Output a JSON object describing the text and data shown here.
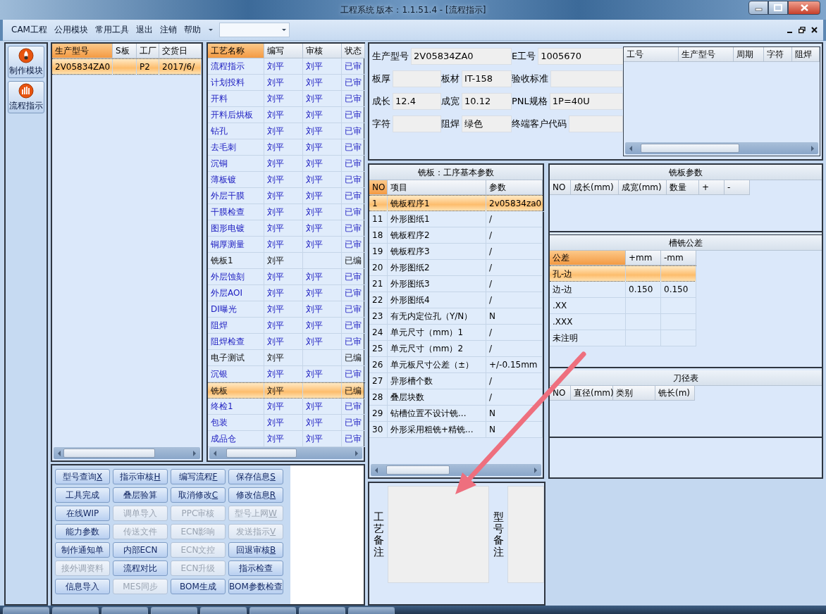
{
  "window": {
    "title": "工程系统   版本：1.1.51.4 - [流程指示]"
  },
  "menu": {
    "items": [
      "CAM工程",
      "公用模块",
      "常用工具",
      "退出",
      "注销",
      "帮助"
    ]
  },
  "navigation": [
    {
      "label": "制作模块"
    },
    {
      "label": "流程指示"
    }
  ],
  "products": {
    "columns": [
      "生产型号",
      "S板",
      "工厂",
      "交货日"
    ],
    "rows": [
      {
        "model": "2V05834ZA0",
        "factory": "P2",
        "delivery_date": "2017/6/",
        "selected": true
      }
    ]
  },
  "processes": {
    "columns": [
      "工艺名称",
      "编写",
      "审核",
      "状态"
    ],
    "rows": [
      {
        "name": "流程指示",
        "writer": "刘平",
        "reviewer": "刘平",
        "status": "已审",
        "reviewed": true,
        "selected": false
      },
      {
        "name": "计划投料",
        "writer": "刘平",
        "reviewer": "刘平",
        "status": "已审",
        "reviewed": true,
        "selected": false
      },
      {
        "name": "开料",
        "writer": "刘平",
        "reviewer": "刘平",
        "status": "已审",
        "reviewed": true,
        "selected": false
      },
      {
        "name": "开料后烘板",
        "writer": "刘平",
        "reviewer": "刘平",
        "status": "已审",
        "reviewed": true,
        "selected": false
      },
      {
        "name": "钻孔",
        "writer": "刘平",
        "reviewer": "刘平",
        "status": "已审",
        "reviewed": true,
        "selected": false
      },
      {
        "name": "去毛刺",
        "writer": "刘平",
        "reviewer": "刘平",
        "status": "已审",
        "reviewed": true,
        "selected": false
      },
      {
        "name": "沉铜",
        "writer": "刘平",
        "reviewer": "刘平",
        "status": "已审",
        "reviewed": true,
        "selected": false
      },
      {
        "name": "薄板镀",
        "writer": "刘平",
        "reviewer": "刘平",
        "status": "已审",
        "reviewed": true,
        "selected": false
      },
      {
        "name": "外层干膜",
        "writer": "刘平",
        "reviewer": "刘平",
        "status": "已审",
        "reviewed": true,
        "selected": false
      },
      {
        "name": "干膜检查",
        "writer": "刘平",
        "reviewer": "刘平",
        "status": "已审",
        "reviewed": true,
        "selected": false
      },
      {
        "name": "图形电镀",
        "writer": "刘平",
        "reviewer": "刘平",
        "status": "已审",
        "reviewed": true,
        "selected": false
      },
      {
        "name": "铜厚测量",
        "writer": "刘平",
        "reviewer": "刘平",
        "status": "已审",
        "reviewed": true,
        "selected": false
      },
      {
        "name": "铣板1",
        "writer": "刘平",
        "status": "已编",
        "reviewed": false,
        "selected": false
      },
      {
        "name": "外层蚀刻",
        "writer": "刘平",
        "reviewer": "刘平",
        "status": "已审",
        "reviewed": true,
        "selected": false
      },
      {
        "name": "外层AOI",
        "writer": "刘平",
        "reviewer": "刘平",
        "status": "已审",
        "reviewed": true,
        "selected": false
      },
      {
        "name": "DI曝光",
        "writer": "刘平",
        "reviewer": "刘平",
        "status": "已审",
        "reviewed": true,
        "selected": false
      },
      {
        "name": "阻焊",
        "writer": "刘平",
        "reviewer": "刘平",
        "status": "已审",
        "reviewed": true,
        "selected": false
      },
      {
        "name": "阻焊检查",
        "writer": "刘平",
        "reviewer": "刘平",
        "status": "已审",
        "reviewed": true,
        "selected": false
      },
      {
        "name": "电子测试",
        "writer": "刘平",
        "status": "已编",
        "reviewed": false,
        "selected": false
      },
      {
        "name": "沉银",
        "writer": "刘平",
        "reviewer": "刘平",
        "status": "已审",
        "reviewed": true,
        "selected": false
      },
      {
        "name": "铣板",
        "writer": "刘平",
        "status": "已编",
        "reviewed": false,
        "selected": true
      },
      {
        "name": "终检1",
        "writer": "刘平",
        "reviewer": "刘平",
        "status": "已审",
        "reviewed": true,
        "selected": false
      },
      {
        "name": "包装",
        "writer": "刘平",
        "reviewer": "刘平",
        "status": "已审",
        "reviewed": true,
        "selected": false
      },
      {
        "name": "成品仓",
        "writer": "刘平",
        "reviewer": "刘平",
        "status": "已审",
        "reviewed": true,
        "selected": false
      }
    ]
  },
  "job_info": {
    "fields": [
      {
        "label": "生产型号",
        "value": "2V05834ZA0"
      },
      {
        "label": "E工号",
        "value": "1005670"
      },
      {
        "label": "板厚"
      },
      {
        "label": "板材",
        "value": "IT-158"
      },
      {
        "label": "验收标准"
      },
      {
        "label": "成长",
        "value": "12.4"
      },
      {
        "label": "成宽",
        "value": "10.12"
      },
      {
        "label": "PNL规格",
        "value": "1P=40U"
      },
      {
        "label": "字符"
      },
      {
        "label": "阻焊",
        "value": "绿色"
      },
      {
        "label": "终端客户代码"
      }
    ]
  },
  "job_list": {
    "columns": [
      "工号",
      "生产型号",
      "周期",
      "字符",
      "阻焊"
    ]
  },
  "basic_params": {
    "title": "铣板：工序基本参数",
    "columns": [
      "NO",
      "项目",
      "参数"
    ],
    "rows": [
      {
        "no": "1",
        "item": "铣板程序1",
        "value": "2v05834za0",
        "selected": true
      },
      {
        "no": "11",
        "item": "外形图纸1",
        "value": "/",
        "selected": false
      },
      {
        "no": "18",
        "item": "铣板程序2",
        "value": "/",
        "selected": false
      },
      {
        "no": "19",
        "item": "铣板程序3",
        "value": "/",
        "selected": false
      },
      {
        "no": "20",
        "item": "外形图纸2",
        "value": "/",
        "selected": false
      },
      {
        "no": "21",
        "item": "外形图纸3",
        "value": "/",
        "selected": false
      },
      {
        "no": "22",
        "item": "外形图纸4",
        "value": "/",
        "selected": false
      },
      {
        "no": "23",
        "item": "有无内定位孔（Y/N）",
        "value": "N",
        "selected": false
      },
      {
        "no": "24",
        "item": "单元尺寸（mm）1",
        "value": "/",
        "selected": false
      },
      {
        "no": "25",
        "item": "单元尺寸（mm）2",
        "value": "/",
        "selected": false
      },
      {
        "no": "26",
        "item": "单元板尺寸公差（±）",
        "value": "+/-0.15mm",
        "selected": false
      },
      {
        "no": "27",
        "item": "异形槽个数",
        "value": "/",
        "selected": false
      },
      {
        "no": "28",
        "item": "叠层块数",
        "value": "/",
        "selected": false
      },
      {
        "no": "29",
        "item": "钻槽位置不设计铣...",
        "value": "N",
        "selected": false
      },
      {
        "no": "30",
        "item": "外形采用粗铣+精铣...",
        "value": "N",
        "selected": false
      }
    ]
  },
  "routing_params": {
    "title": "铣板参数",
    "columns": [
      "NO",
      "成长(mm)",
      "成宽(mm)",
      "数量",
      "+",
      "-"
    ]
  },
  "slot_tolerance": {
    "title": "槽铣公差",
    "columns": [
      "公差",
      "+mm",
      "-mm"
    ],
    "rows": [
      {
        "name": "孔-边",
        "selected": true
      },
      {
        "name": "边-边",
        "plus": "0.150",
        "minus": "0.150",
        "selected": false
      },
      {
        "name": ".XX",
        "selected": false
      },
      {
        "name": ".XXX",
        "selected": false
      },
      {
        "name": "未注明",
        "selected": false
      }
    ]
  },
  "tool_table": {
    "title": "刀径表",
    "columns": [
      "NO",
      "直径(mm)",
      "类别",
      "铣长(m)"
    ]
  },
  "actions": [
    {
      "label": "型号查询",
      "shortcut": "X",
      "disabled": false
    },
    {
      "label": "指示审核",
      "shortcut": "H",
      "disabled": false
    },
    {
      "label": "编写流程",
      "shortcut": "F",
      "disabled": false
    },
    {
      "label": "保存信息",
      "shortcut": "S",
      "disabled": false
    },
    {
      "label": "工具完成",
      "disabled": false
    },
    {
      "label": "叠层验算",
      "disabled": false
    },
    {
      "label": "取消修改",
      "shortcut": "C",
      "disabled": false
    },
    {
      "label": "修改信息",
      "shortcut": "R",
      "disabled": false
    },
    {
      "label": "在线WIP",
      "disabled": false
    },
    {
      "label": "调单导入",
      "disabled": true
    },
    {
      "label": "PPC审核",
      "disabled": true
    },
    {
      "label": "型号上网",
      "shortcut": "W",
      "disabled": true
    },
    {
      "label": "能力参数",
      "disabled": false
    },
    {
      "label": "传送文件",
      "disabled": true
    },
    {
      "label": "ECN影响",
      "disabled": true
    },
    {
      "label": "发送指示",
      "shortcut": "V",
      "disabled": true
    },
    {
      "label": "制作通知单",
      "disabled": false
    },
    {
      "label": "内部ECN",
      "disabled": false
    },
    {
      "label": "ECN文控",
      "disabled": true
    },
    {
      "label": "回退审核",
      "shortcut": "B",
      "disabled": false
    },
    {
      "label": "接外调资料",
      "disabled": true
    },
    {
      "label": "流程对比",
      "disabled": false
    },
    {
      "label": "ECN升级",
      "disabled": true
    },
    {
      "label": "指示检查",
      "disabled": false
    },
    {
      "label": "信息导入",
      "disabled": false
    },
    {
      "label": "MES同步",
      "disabled": true
    },
    {
      "label": "BOM生成",
      "disabled": false
    },
    {
      "label": "BOM参数检查",
      "disabled": false
    }
  ],
  "remarks": [
    {
      "label": "工艺备注"
    },
    {
      "label": "型号备注"
    }
  ]
}
